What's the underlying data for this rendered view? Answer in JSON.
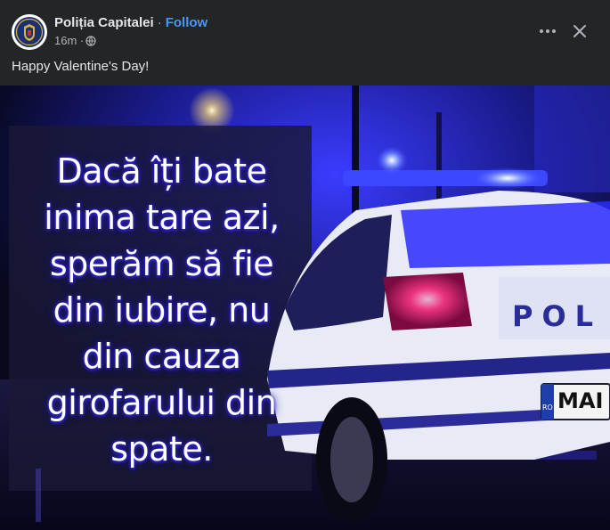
{
  "post": {
    "page_name": "Poliția Capitalei",
    "separator": "·",
    "follow_label": "Follow",
    "time": "16m ·",
    "caption": "Happy Valentine's Day!"
  },
  "icons": {
    "avatar": "police-crest-icon",
    "audience": "globe-icon",
    "more": "more-horizontal-icon",
    "close": "close-icon"
  },
  "image": {
    "text_lines": [
      "Dacă îți bate",
      "inima tare azi,",
      "sperăm să fie",
      "din iubire, nu",
      "din cauza",
      "girofarului din",
      "spate."
    ],
    "car_door_text": "POL",
    "plate_text": "MAI",
    "plate_prefix": "RO"
  },
  "colors": {
    "background": "#242526",
    "link": "#4599ff",
    "text": "#e4e6eb",
    "muted": "#b0b3b8",
    "police_blue": "#2a2cff"
  }
}
